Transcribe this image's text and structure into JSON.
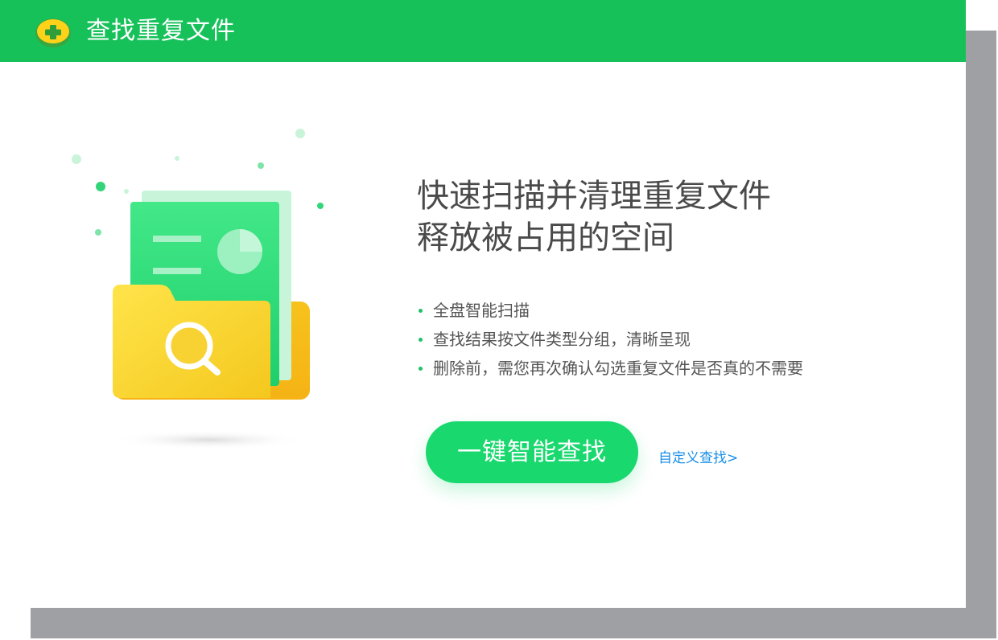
{
  "window": {
    "title": "查找重复文件",
    "app_icon": "app-plus-logo-icon",
    "accent_color": "#17c15a"
  },
  "main": {
    "headline_line1": "快速扫描并清理重复文件",
    "headline_line2": "释放被占用的空间",
    "features": [
      "全盘智能扫描",
      "查找结果按文件类型分组，清晰呈现",
      "删除前，需您再次确认勾选重复文件是否真的不需要"
    ],
    "primary_button": {
      "label": "一键智能查找",
      "color": "#18d86e"
    },
    "custom_link": "自定义查找>",
    "link_color": "#1b8fe8",
    "illustration": "folder-search-illustration"
  }
}
